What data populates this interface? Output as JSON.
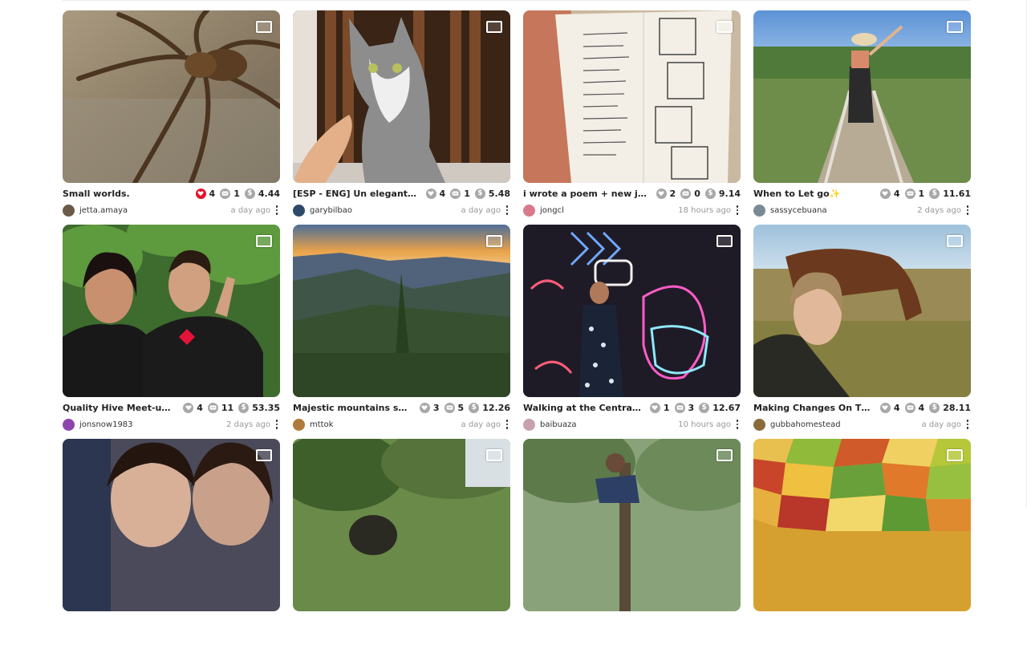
{
  "posts": [
    {
      "title": "Small worlds.",
      "likes": "4",
      "liked": true,
      "comments": "1",
      "payout": "4.44",
      "author": "jetta.amaya",
      "time": "a day ago",
      "avatar_color": "#6b5a4a",
      "image": "spider"
    },
    {
      "title": "[ESP - ENG] Un elegante gato ...",
      "likes": "4",
      "liked": false,
      "comments": "1",
      "payout": "5.48",
      "author": "garybilbao",
      "time": "a day ago",
      "avatar_color": "#2e4a6b",
      "image": "cat"
    },
    {
      "title": "i wrote a poem + new journal ...",
      "likes": "2",
      "liked": false,
      "comments": "0",
      "payout": "9.14",
      "author": "jongcl",
      "time": "18 hours ago",
      "avatar_color": "#d97a8a",
      "image": "journal"
    },
    {
      "title": "When to Let go✨",
      "likes": "4",
      "liked": false,
      "comments": "1",
      "payout": "11.61",
      "author": "sassycebuana",
      "time": "2 days ago",
      "avatar_color": "#7a8a94",
      "image": "bridge"
    },
    {
      "title": "Quality Hive Meet-up with ...",
      "likes": "4",
      "liked": false,
      "comments": "11",
      "payout": "53.35",
      "author": "jonsnow1983",
      "time": "2 days ago",
      "avatar_color": "#8e44ad",
      "image": "meetup"
    },
    {
      "title": "Majestic mountains seen fro...",
      "likes": "3",
      "liked": false,
      "comments": "5",
      "payout": "12.26",
      "author": "mttok",
      "time": "a day ago",
      "avatar_color": "#b07a3a",
      "image": "mountains"
    },
    {
      "title": "Walking at the Central Depa...",
      "likes": "1",
      "liked": false,
      "comments": "3",
      "payout": "12.67",
      "author": "baibuaza",
      "time": "10 hours ago",
      "avatar_color": "#c9a0b0",
      "image": "neon"
    },
    {
      "title": "Making Changes On The Ho...",
      "likes": "4",
      "liked": false,
      "comments": "4",
      "payout": "28.11",
      "author": "gubbahomestead",
      "time": "a day ago",
      "avatar_color": "#8a6a3a",
      "image": "cow"
    },
    {
      "title": "",
      "likes": "",
      "liked": false,
      "comments": "",
      "payout": "",
      "author": "",
      "time": "",
      "avatar_color": "#ccc",
      "image": "selfie"
    },
    {
      "title": "",
      "likes": "",
      "liked": false,
      "comments": "",
      "payout": "",
      "author": "",
      "time": "",
      "avatar_color": "#ccc",
      "image": "forest"
    },
    {
      "title": "",
      "likes": "",
      "liked": false,
      "comments": "",
      "payout": "",
      "author": "",
      "time": "",
      "avatar_color": "#ccc",
      "image": "tree"
    },
    {
      "title": "",
      "likes": "",
      "liked": false,
      "comments": "",
      "payout": "",
      "author": "",
      "time": "",
      "avatar_color": "#ccc",
      "image": "mosaic"
    }
  ],
  "icons": {
    "like": "heart-icon",
    "comment": "chat-bubble-icon",
    "payout": "dollar-coin-icon",
    "more": "more-vertical-icon",
    "type": "image-gallery-icon"
  },
  "colors": {
    "liked": "#e3132b",
    "icon_grey": "#a8a8a8",
    "text": "#222222",
    "muted": "#999999"
  }
}
